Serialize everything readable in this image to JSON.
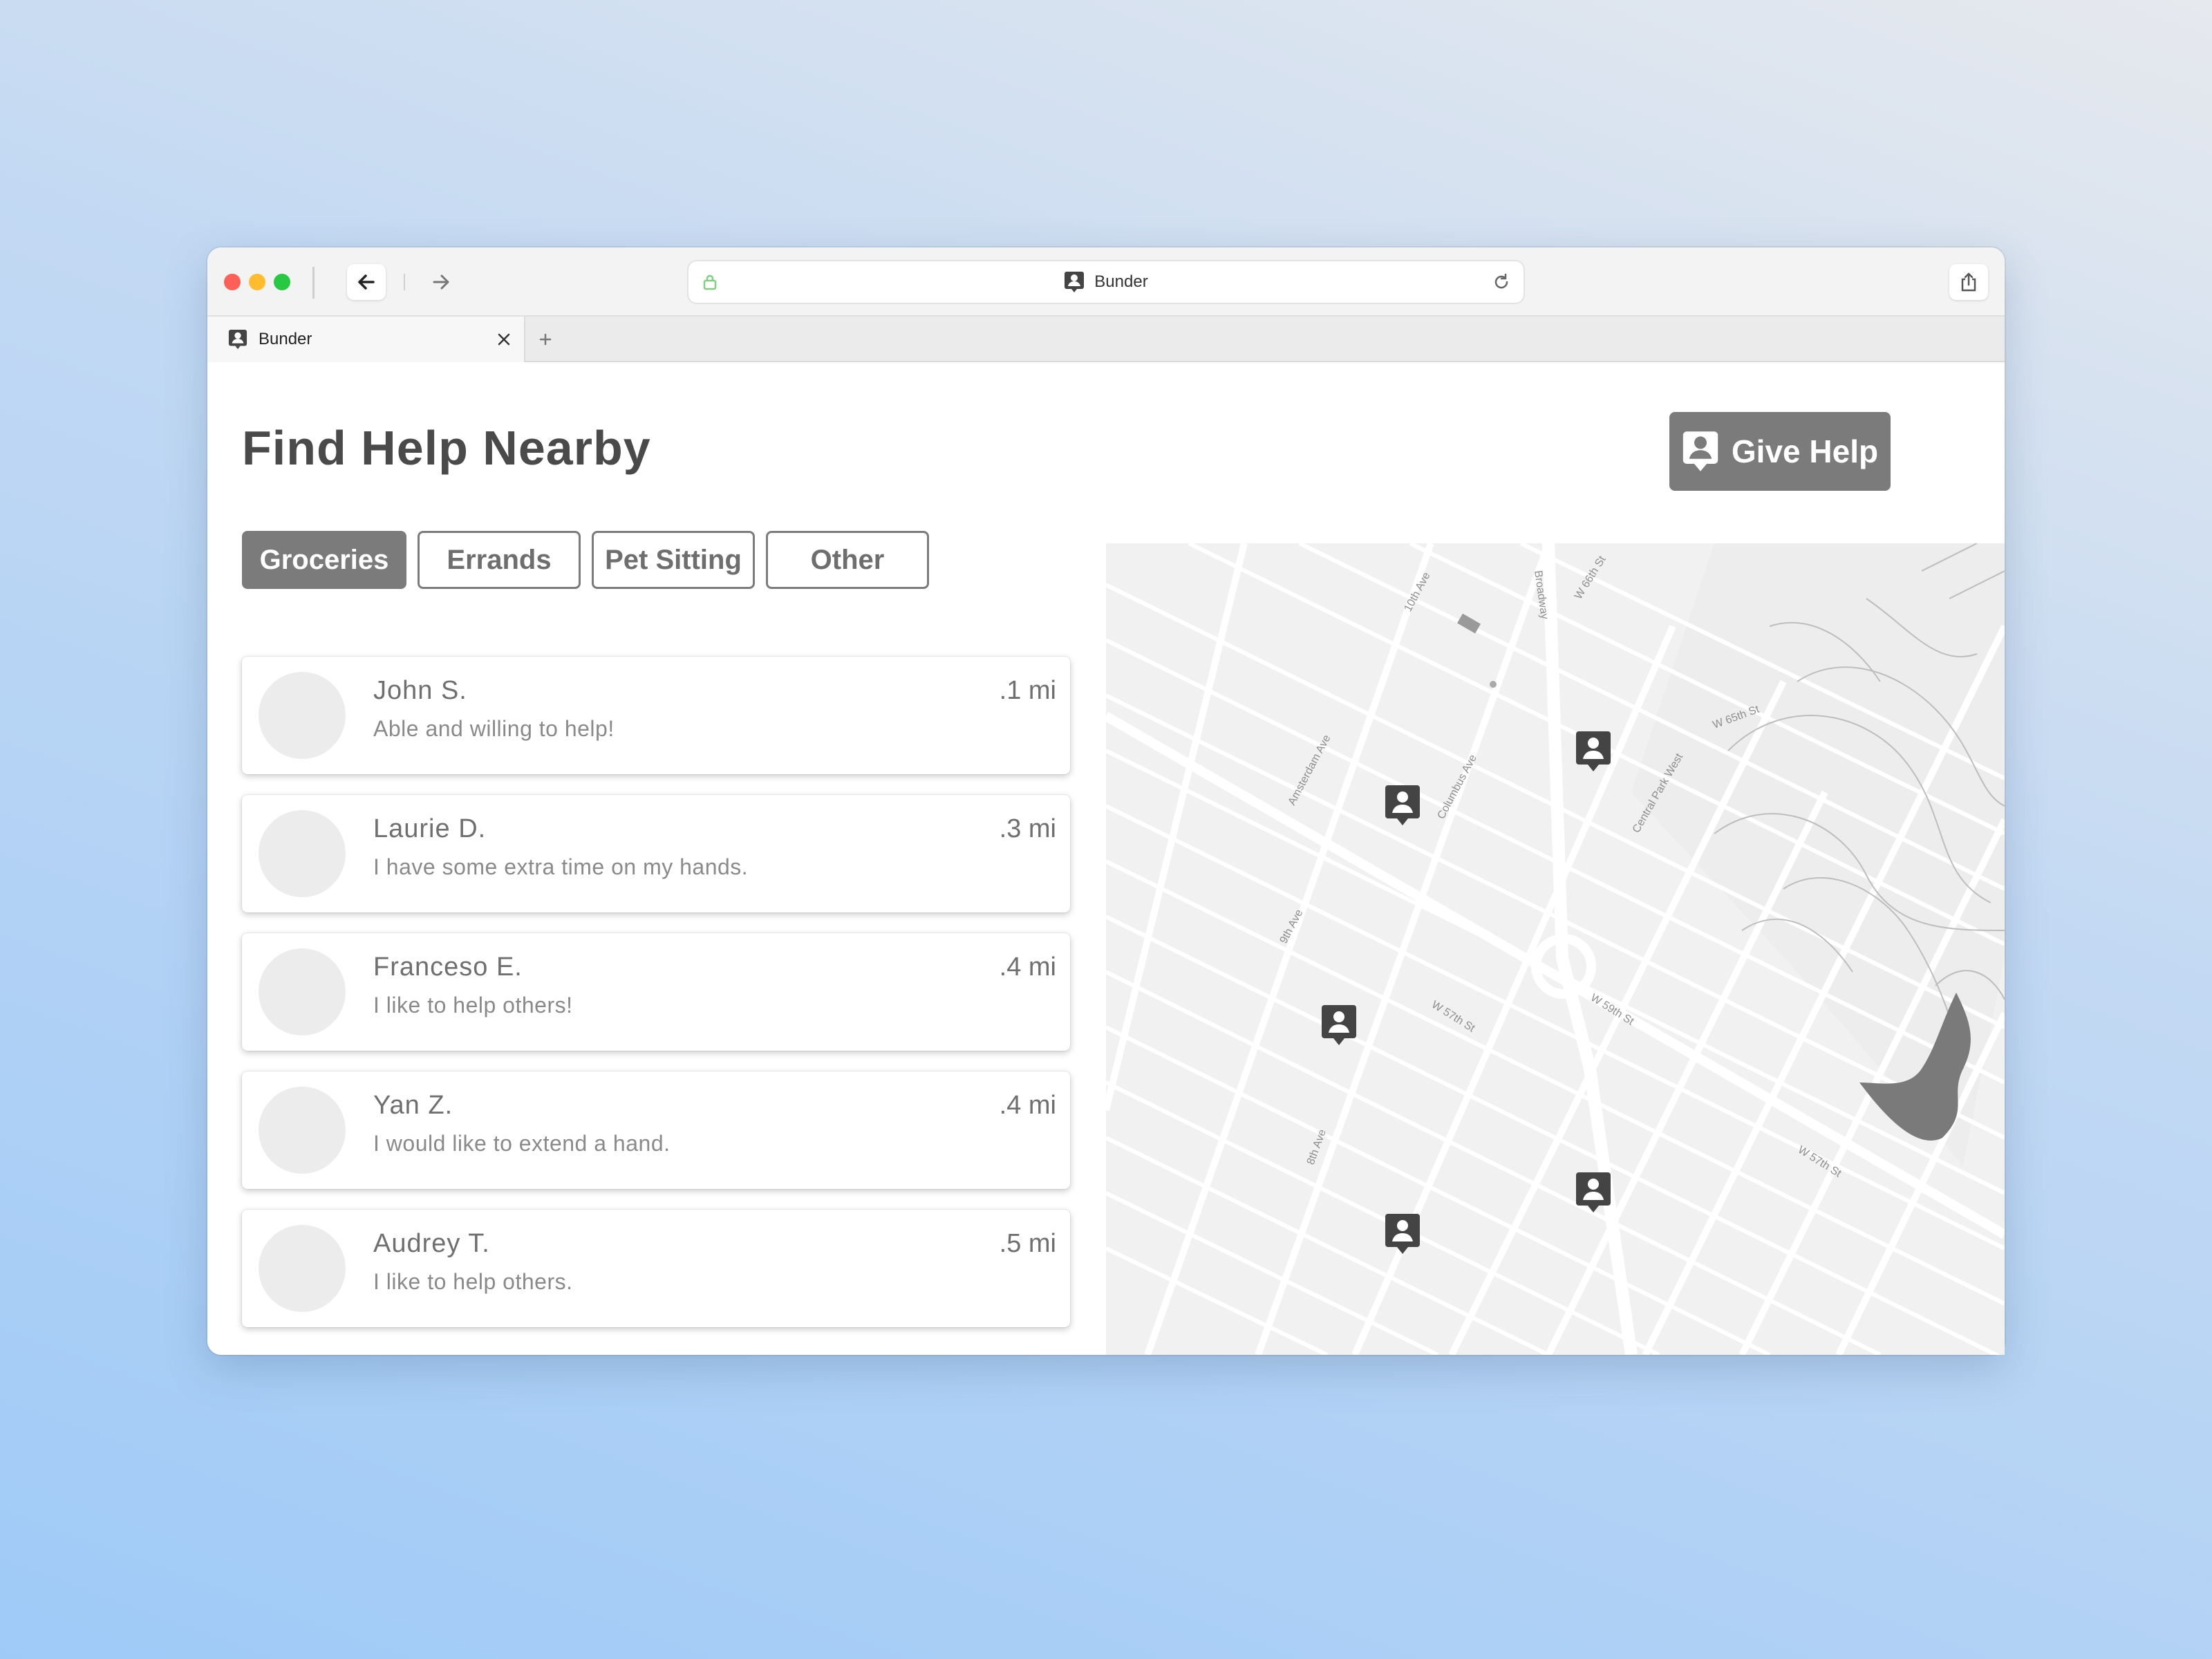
{
  "browser": {
    "address_text": "Bunder",
    "tab_title": "Bunder",
    "icons": {
      "back": "arrow-left-icon",
      "forward": "arrow-right-icon",
      "lock": "lock-icon",
      "reload": "reload-icon",
      "share": "share-icon",
      "close": "close-icon",
      "new_tab": "plus-icon"
    }
  },
  "page": {
    "title": "Find Help Nearby",
    "give_help_label": "Give Help"
  },
  "filters": [
    {
      "label": "Groceries",
      "active": true
    },
    {
      "label": "Errands",
      "active": false
    },
    {
      "label": "Pet Sitting",
      "active": false
    },
    {
      "label": "Other",
      "active": false
    }
  ],
  "helpers": [
    {
      "name": "John S.",
      "message": "Able and willing to help!",
      "distance": ".1 mi"
    },
    {
      "name": "Laurie D.",
      "message": "I have some extra time on my hands.",
      "distance": ".3 mi"
    },
    {
      "name": "Franceso E.",
      "message": "I like to help others!",
      "distance": ".4 mi"
    },
    {
      "name": "Yan Z.",
      "message": "I would like to extend a hand.",
      "distance": ".4 mi"
    },
    {
      "name": "Audrey T.",
      "message": "I like to help others.",
      "distance": ".5 mi"
    }
  ],
  "map": {
    "street_labels": [
      "W 65th St",
      "W 66th St",
      "W 59th St",
      "W 57th St",
      "Broadway",
      "Columbus Ave",
      "Amsterdam Ave",
      "10th Ave",
      "9th Ave",
      "8th Ave",
      "Central Park West",
      "W 57th St"
    ],
    "marker_icon": "person-pin-icon"
  },
  "colors": {
    "accent_gray": "#7b7b7b",
    "title_text": "#4a4a4a",
    "map_background": "#f1f1f1"
  }
}
